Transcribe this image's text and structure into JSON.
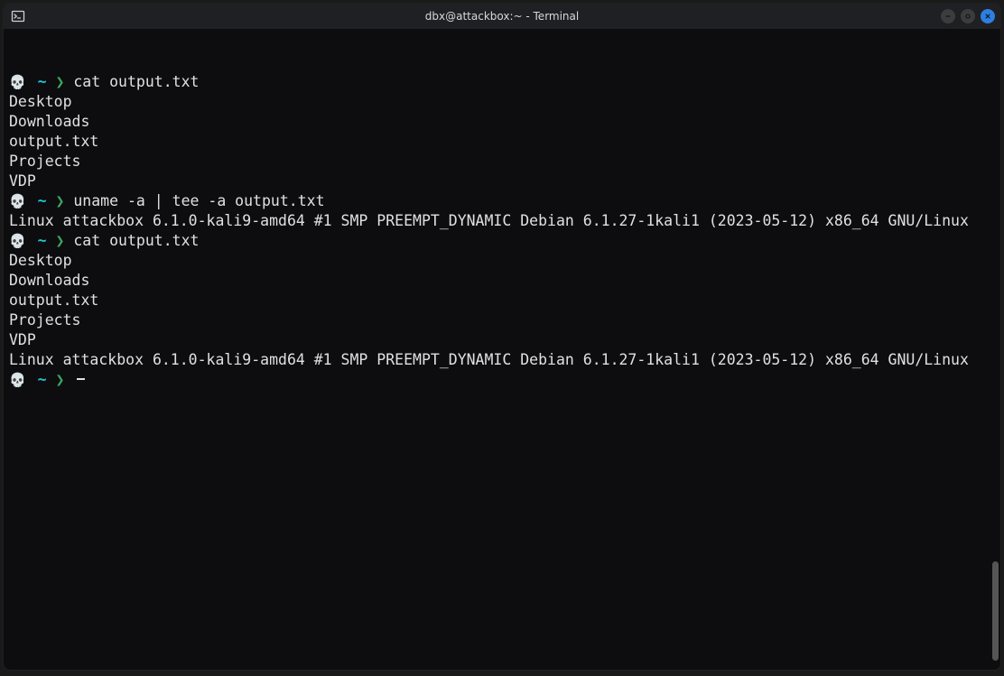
{
  "window": {
    "title": "dbx@attackbox:~ - Terminal"
  },
  "prompt": {
    "skull": "💀",
    "path": "~",
    "arrow": "❯"
  },
  "session": [
    {
      "type": "cmd",
      "text": "cat output.txt"
    },
    {
      "type": "out",
      "text": "Desktop"
    },
    {
      "type": "out",
      "text": "Downloads"
    },
    {
      "type": "out",
      "text": "output.txt"
    },
    {
      "type": "out",
      "text": "Projects"
    },
    {
      "type": "out",
      "text": "VDP"
    },
    {
      "type": "cmd",
      "text": "uname -a | tee -a output.txt"
    },
    {
      "type": "out",
      "text": "Linux attackbox 6.1.0-kali9-amd64 #1 SMP PREEMPT_DYNAMIC Debian 6.1.27-1kali1 (2023-05-12) x86_64 GNU/Linux"
    },
    {
      "type": "cmd",
      "text": "cat output.txt"
    },
    {
      "type": "out",
      "text": "Desktop"
    },
    {
      "type": "out",
      "text": "Downloads"
    },
    {
      "type": "out",
      "text": "output.txt"
    },
    {
      "type": "out",
      "text": "Projects"
    },
    {
      "type": "out",
      "text": "VDP"
    },
    {
      "type": "out",
      "text": "Linux attackbox 6.1.0-kali9-amd64 #1 SMP PREEMPT_DYNAMIC Debian 6.1.27-1kali1 (2023-05-12) x86_64 GNU/Linux"
    },
    {
      "type": "cmd",
      "text": "",
      "cursor": true
    }
  ]
}
